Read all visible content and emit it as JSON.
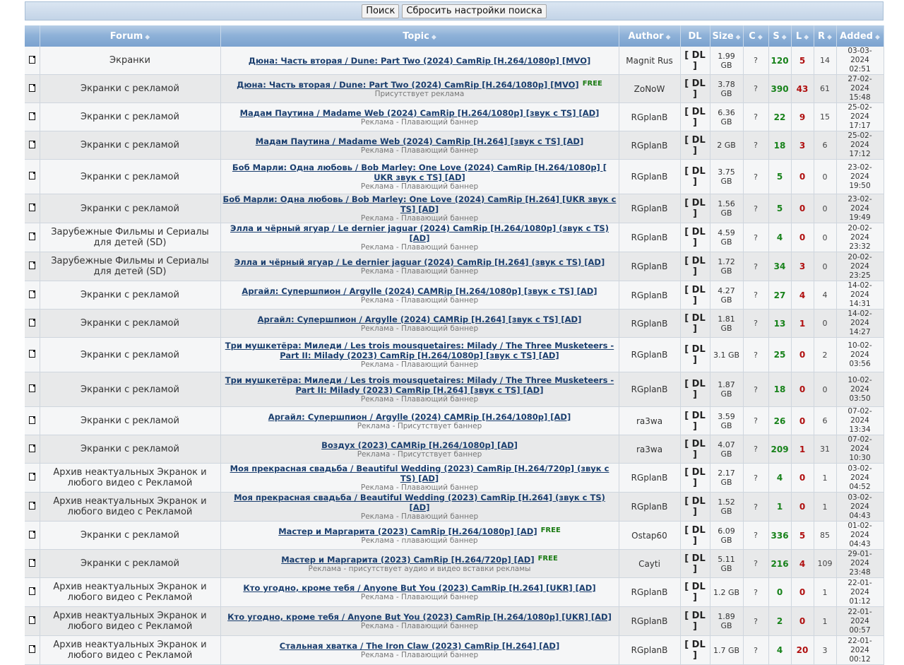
{
  "search": {
    "search_label": "Поиск",
    "reset_label": "Сбросить настройки поиска"
  },
  "columns": {
    "forum": "Forum",
    "topic": "Topic",
    "author": "Author",
    "dl": "DL",
    "size": "Size",
    "c": "C",
    "s": "S",
    "l": "L",
    "r": "R",
    "added": "Added"
  },
  "dl_label": "[ DL ]",
  "free_label": "FREE",
  "rows": [
    {
      "forum": "Экранки",
      "title": "Дюна: Часть вторая / Dune: Part Two (2024) CamRip [H.264/1080p] [MVO]",
      "sub": "",
      "free": false,
      "author": "Magnit Rus",
      "size": "1.99 GB",
      "c": "?",
      "s": "120",
      "l": "5",
      "r": "14",
      "date": "03-03-2024",
      "time": "02:51",
      "h": 33
    },
    {
      "forum": "Экранки с рекламой",
      "title": "Дюна: Часть вторая / Dune: Part Two (2024) CamRip [H.264/1080p] [MVO]",
      "sub": "Присутствует реклама",
      "free": true,
      "author": "ZoNoW",
      "size": "3.78 GB",
      "c": "?",
      "s": "390",
      "l": "43",
      "r": "61",
      "date": "27-02-2024",
      "time": "15:48",
      "h": 36
    },
    {
      "forum": "Экранки с рекламой",
      "title": "Мадам Паутина / Madame Web (2024) CamRip [H.264/1080p] [звук с TS] [AD]",
      "sub": "Реклама - Плавающий баннер",
      "free": false,
      "author": "RGplanB",
      "size": "6.36 GB",
      "c": "?",
      "s": "22",
      "l": "9",
      "r": "15",
      "date": "25-02-2024",
      "time": "17:17",
      "h": 36
    },
    {
      "forum": "Экранки с рекламой",
      "title": "Мадам Паутина / Madame Web (2024) CamRip [H.264] [звук с TS] [AD]",
      "sub": "Реклама - Плавающий баннер",
      "free": false,
      "author": "RGplanB",
      "size": "2 GB",
      "c": "?",
      "s": "18",
      "l": "3",
      "r": "6",
      "date": "25-02-2024",
      "time": "17:12",
      "h": 36
    },
    {
      "forum": "Экранки с рекламой",
      "title": "Боб Марли: Одна любовь / Bob Marley: One Love (2024) CamRip [H.264/1080p] [ UKR звук с TS] [AD]",
      "sub": "Реклама - Плавающий баннер",
      "free": false,
      "author": "RGplanB",
      "size": "3.75 GB",
      "c": "?",
      "s": "5",
      "l": "0",
      "r": "0",
      "date": "23-02-2024",
      "time": "19:50",
      "h": 49
    },
    {
      "forum": "Экранки с рекламой",
      "title": "Боб Марли: Одна любовь / Bob Marley: One Love (2024) CamRip [H.264] [UKR звук с TS] [AD]",
      "sub": "Реклама - Плавающий баннер",
      "free": false,
      "author": "RGplanB",
      "size": "1.56 GB",
      "c": "?",
      "s": "5",
      "l": "0",
      "r": "0",
      "date": "23-02-2024",
      "time": "19:49",
      "h": 36
    },
    {
      "forum": "Зарубежные Фильмы и Сериалы для детей (SD)",
      "title": "Элла и чёрный ягуар / Le dernier jaguar (2024) CamRip [H.264/1080p] (звук с TS) [AD]",
      "sub": "Реклама - Плавающий баннер",
      "free": false,
      "author": "RGplanB",
      "size": "4.59 GB",
      "c": "?",
      "s": "4",
      "l": "0",
      "r": "0",
      "date": "20-02-2024",
      "time": "23:32",
      "h": 41
    },
    {
      "forum": "Зарубежные Фильмы и Сериалы для детей (SD)",
      "title": "Элла и чёрный ягуар / Le dernier jaguar (2024) CamRip [H.264] (звук с TS) [AD]",
      "sub": "Реклама - Плавающий баннер",
      "free": false,
      "author": "RGplanB",
      "size": "1.72 GB",
      "c": "?",
      "s": "34",
      "l": "3",
      "r": "0",
      "date": "20-02-2024",
      "time": "23:25",
      "h": 41
    },
    {
      "forum": "Экранки с рекламой",
      "title": "Аргайл: Супершпион / Argylle (2024) CAMRip [H.264/1080p] [звук с TS] [AD]",
      "sub": "Реклама - Плавающий баннер",
      "free": false,
      "author": "RGplanB",
      "size": "4.27 GB",
      "c": "?",
      "s": "27",
      "l": "4",
      "r": "4",
      "date": "14-02-2024",
      "time": "14:31",
      "h": 36
    },
    {
      "forum": "Экранки с рекламой",
      "title": "Аргайл: Супершпион / Argylle (2024) CAMRip [H.264] [звук с TS] [AD]",
      "sub": "Реклама - Плавающий баннер",
      "free": false,
      "author": "RGplanB",
      "size": "1.81 GB",
      "c": "?",
      "s": "13",
      "l": "1",
      "r": "0",
      "date": "14-02-2024",
      "time": "14:27",
      "h": 36
    },
    {
      "forum": "Экранки с рекламой",
      "title": "Три мушкетёра: Миледи / Les trois mousquetaires: Milady / The Three Musketeers - Part II: Milady (2023) CamRip [H.264/1080p] [звук с TS] [AD]",
      "sub": "Реклама - Плавающий баннер",
      "free": false,
      "author": "RGplanB",
      "size": "3.1 GB",
      "c": "?",
      "s": "25",
      "l": "0",
      "r": "2",
      "date": "10-02-2024",
      "time": "03:56",
      "h": 49
    },
    {
      "forum": "Экранки с рекламой",
      "title": "Три мушкетёра: Миледи / Les trois mousquetaires: Milady / The Three Musketeers - Part II: Milady (2023) CamRip [H.264] [звук с TS] [AD]",
      "sub": "Реклама - Плавающий баннер",
      "free": false,
      "author": "RGplanB",
      "size": "1.87 GB",
      "c": "?",
      "s": "18",
      "l": "0",
      "r": "0",
      "date": "10-02-2024",
      "time": "03:50",
      "h": 49
    },
    {
      "forum": "Экранки с рекламой",
      "title": "Аргайл: Супершпион / Argylle (2024) CAMRip [H.264/1080p] [AD]",
      "sub": "Реклама - Присутствует баннер",
      "free": false,
      "author": "ra3wa",
      "size": "3.59 GB",
      "c": "?",
      "s": "26",
      "l": "0",
      "r": "6",
      "date": "07-02-2024",
      "time": "13:34",
      "h": 36
    },
    {
      "forum": "Экранки с рекламой",
      "title": "Воздух (2023) CAMRip [H.264/1080p] [AD]",
      "sub": "Реклама - Присутствует баннер",
      "free": false,
      "author": "ra3wa",
      "size": "4.07 GB",
      "c": "?",
      "s": "209",
      "l": "1",
      "r": "31",
      "date": "07-02-2024",
      "time": "10:30",
      "h": 36
    },
    {
      "forum": "Архив неактуальных Экранок и любого видео с Рекламой",
      "title": "Моя прекрасная свадьба / Beautiful Wedding (2023) CamRip [H.264/720p] (звук с TS) [AD]",
      "sub": "Реклама - Плавающий баннер",
      "free": false,
      "author": "RGplanB",
      "size": "2.17 GB",
      "c": "?",
      "s": "4",
      "l": "0",
      "r": "1",
      "date": "03-02-2024",
      "time": "04:52",
      "h": 41
    },
    {
      "forum": "Архив неактуальных Экранок и любого видео с Рекламой",
      "title": "Моя прекрасная свадьба / Beautiful Wedding (2023) CamRip [H.264] (звук с TS) [AD]",
      "sub": "Реклама - Плавающий баннер",
      "free": false,
      "author": "RGplanB",
      "size": "1.52 GB",
      "c": "?",
      "s": "1",
      "l": "0",
      "r": "1",
      "date": "03-02-2024",
      "time": "04:43",
      "h": 41
    },
    {
      "forum": "Экранки с рекламой",
      "title": "Мастер и Маргарита (2023) CamRip [H.264/1080p] [AD]",
      "sub": "Реклама - плавающий баннер",
      "free": true,
      "author": "Ostap60",
      "size": "6.09 GB",
      "c": "?",
      "s": "336",
      "l": "5",
      "r": "85",
      "date": "01-02-2024",
      "time": "04:43",
      "h": 36
    },
    {
      "forum": "Экранки с рекламой",
      "title": "Мастер и Маргарита (2023) CamRip [H.264/720p] [AD]",
      "sub": "Реклама - присутствует аудио и видео вставки рекламы",
      "free": true,
      "author": "Cayti",
      "size": "5.11 GB",
      "c": "?",
      "s": "216",
      "l": "4",
      "r": "109",
      "date": "29-01-2024",
      "time": "23:48",
      "h": 36
    },
    {
      "forum": "Архив неактуальных Экранок и любого видео с Рекламой",
      "title": "Кто угодно, кроме тебя / Anyone But You (2023) CamRip [H.264] [UKR] [AD]",
      "sub": "Реклама - Плавающий баннер",
      "free": false,
      "author": "RGplanB",
      "size": "1.2 GB",
      "c": "?",
      "s": "0",
      "l": "0",
      "r": "1",
      "date": "22-01-2024",
      "time": "01:12",
      "h": 41
    },
    {
      "forum": "Архив неактуальных Экранок и любого видео с Рекламой",
      "title": "Кто угодно, кроме тебя / Anyone But You (2023) CamRip [H.264/1080p] [UKR] [AD]",
      "sub": "Реклама - Плавающий баннер",
      "free": false,
      "author": "RGplanB",
      "size": "1.89 GB",
      "c": "?",
      "s": "2",
      "l": "0",
      "r": "1",
      "date": "22-01-2024",
      "time": "00:57",
      "h": 41
    },
    {
      "forum": "Архив неактуальных Экранок и любого видео с Рекламой",
      "title": "Стальная хватка / The Iron Claw (2023) CamRip [H.264] [AD]",
      "sub": "Реклама - Плавающий баннер",
      "free": false,
      "author": "RGplanB",
      "size": "1.7 GB",
      "c": "?",
      "s": "4",
      "l": "20",
      "r": "3",
      "date": "22-01-2024",
      "time": "00:12",
      "h": 41
    }
  ]
}
